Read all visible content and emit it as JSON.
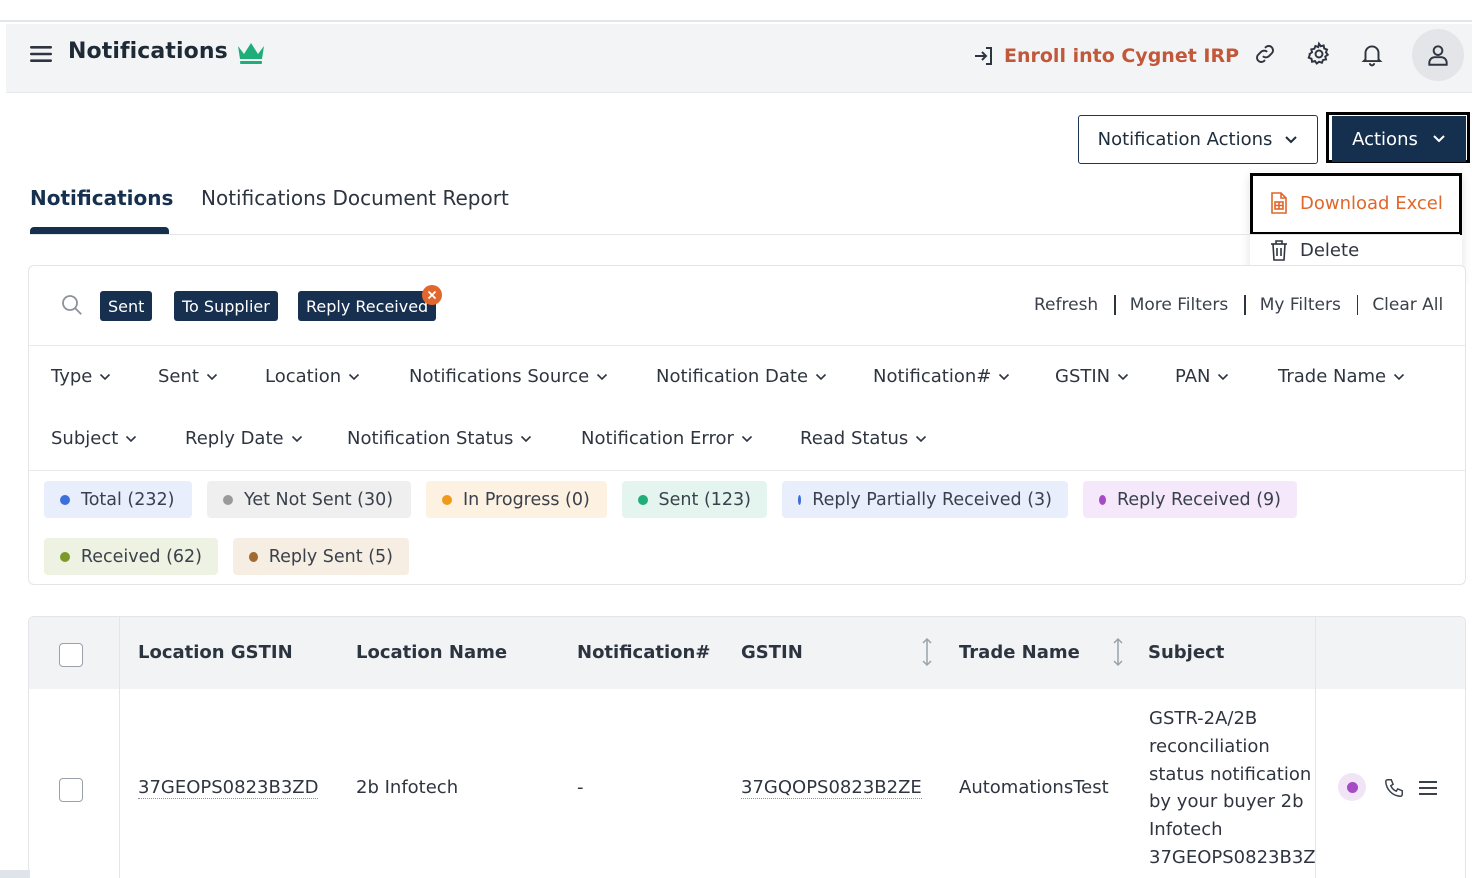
{
  "header": {
    "title": "Notifications",
    "enroll_label": "Enroll into Cygnet IRP"
  },
  "buttons": {
    "notification_actions": "Notification Actions",
    "actions": "Actions"
  },
  "actions_menu": {
    "download_excel": "Download Excel",
    "delete": "Delete"
  },
  "tabs": [
    {
      "label": "Notifications",
      "active": true
    },
    {
      "label": "Notifications Document Report",
      "active": false
    }
  ],
  "filter_chips": [
    "Sent",
    "To Supplier",
    "Reply Received"
  ],
  "filter_links": [
    "Refresh",
    "More Filters",
    "My Filters",
    "Clear All"
  ],
  "filter_dropdowns_row1": [
    "Type",
    "Sent",
    "Location",
    "Notifications Source",
    "Notification Date",
    "Notification#",
    "GSTIN",
    "PAN",
    "Trade Name"
  ],
  "filter_dropdowns_row2": [
    "Subject",
    "Reply Date",
    "Notification Status",
    "Notification Error",
    "Read Status"
  ],
  "status_pills": [
    {
      "label": "Total (232)",
      "dot": "#3b6fd9",
      "bg": "#e8eefb"
    },
    {
      "label": "Yet Not Sent (30)",
      "dot": "#9a9a9a",
      "bg": "#efefef"
    },
    {
      "label": "In Progress (0)",
      "dot": "#f09a1a",
      "bg": "#fdf1e2"
    },
    {
      "label": "Sent (123)",
      "dot": "#1fae7a",
      "bg": "#e3f5ee"
    },
    {
      "label": "Reply Partially Received (3)",
      "dot": "#3b6fd9",
      "bg": "#e8eefb"
    },
    {
      "label": "Reply Received (9)",
      "dot": "#a54cc5",
      "bg": "#f5e8fa"
    },
    {
      "label": "Received (62)",
      "dot": "#7c9a2a",
      "bg": "#eef2e3"
    },
    {
      "label": "Reply Sent (5)",
      "dot": "#a06a30",
      "bg": "#f6ede3"
    }
  ],
  "table": {
    "columns": [
      "Location GSTIN",
      "Location Name",
      "Notification#",
      "GSTIN",
      "Trade Name",
      "Subject"
    ],
    "rows": [
      {
        "location_gstin": "37GEOPS0823B3ZD",
        "location_name": "2b Infotech",
        "notification_no": "-",
        "gstin": "37GQOPS0823B2ZE",
        "trade_name": "AutomationsTest",
        "subject_lines": [
          "GSTR-2A/2B",
          "reconciliation",
          "status notification",
          "by your buyer 2b",
          "Infotech",
          "37GEOPS0823B3Z"
        ],
        "status_dot": "#a54cc5"
      }
    ]
  },
  "colors": {
    "primary": "#152f4f",
    "accent": "#c2583a",
    "crown": "#1fae7a"
  },
  "icons": [
    "menu-icon",
    "crown-icon",
    "login-icon",
    "link-icon",
    "gear-icon",
    "bell-icon",
    "user-icon",
    "chevron-down-icon",
    "excel-file-icon",
    "trash-icon",
    "search-icon",
    "close-icon",
    "sort-icon",
    "phone-icon",
    "list-icon"
  ]
}
